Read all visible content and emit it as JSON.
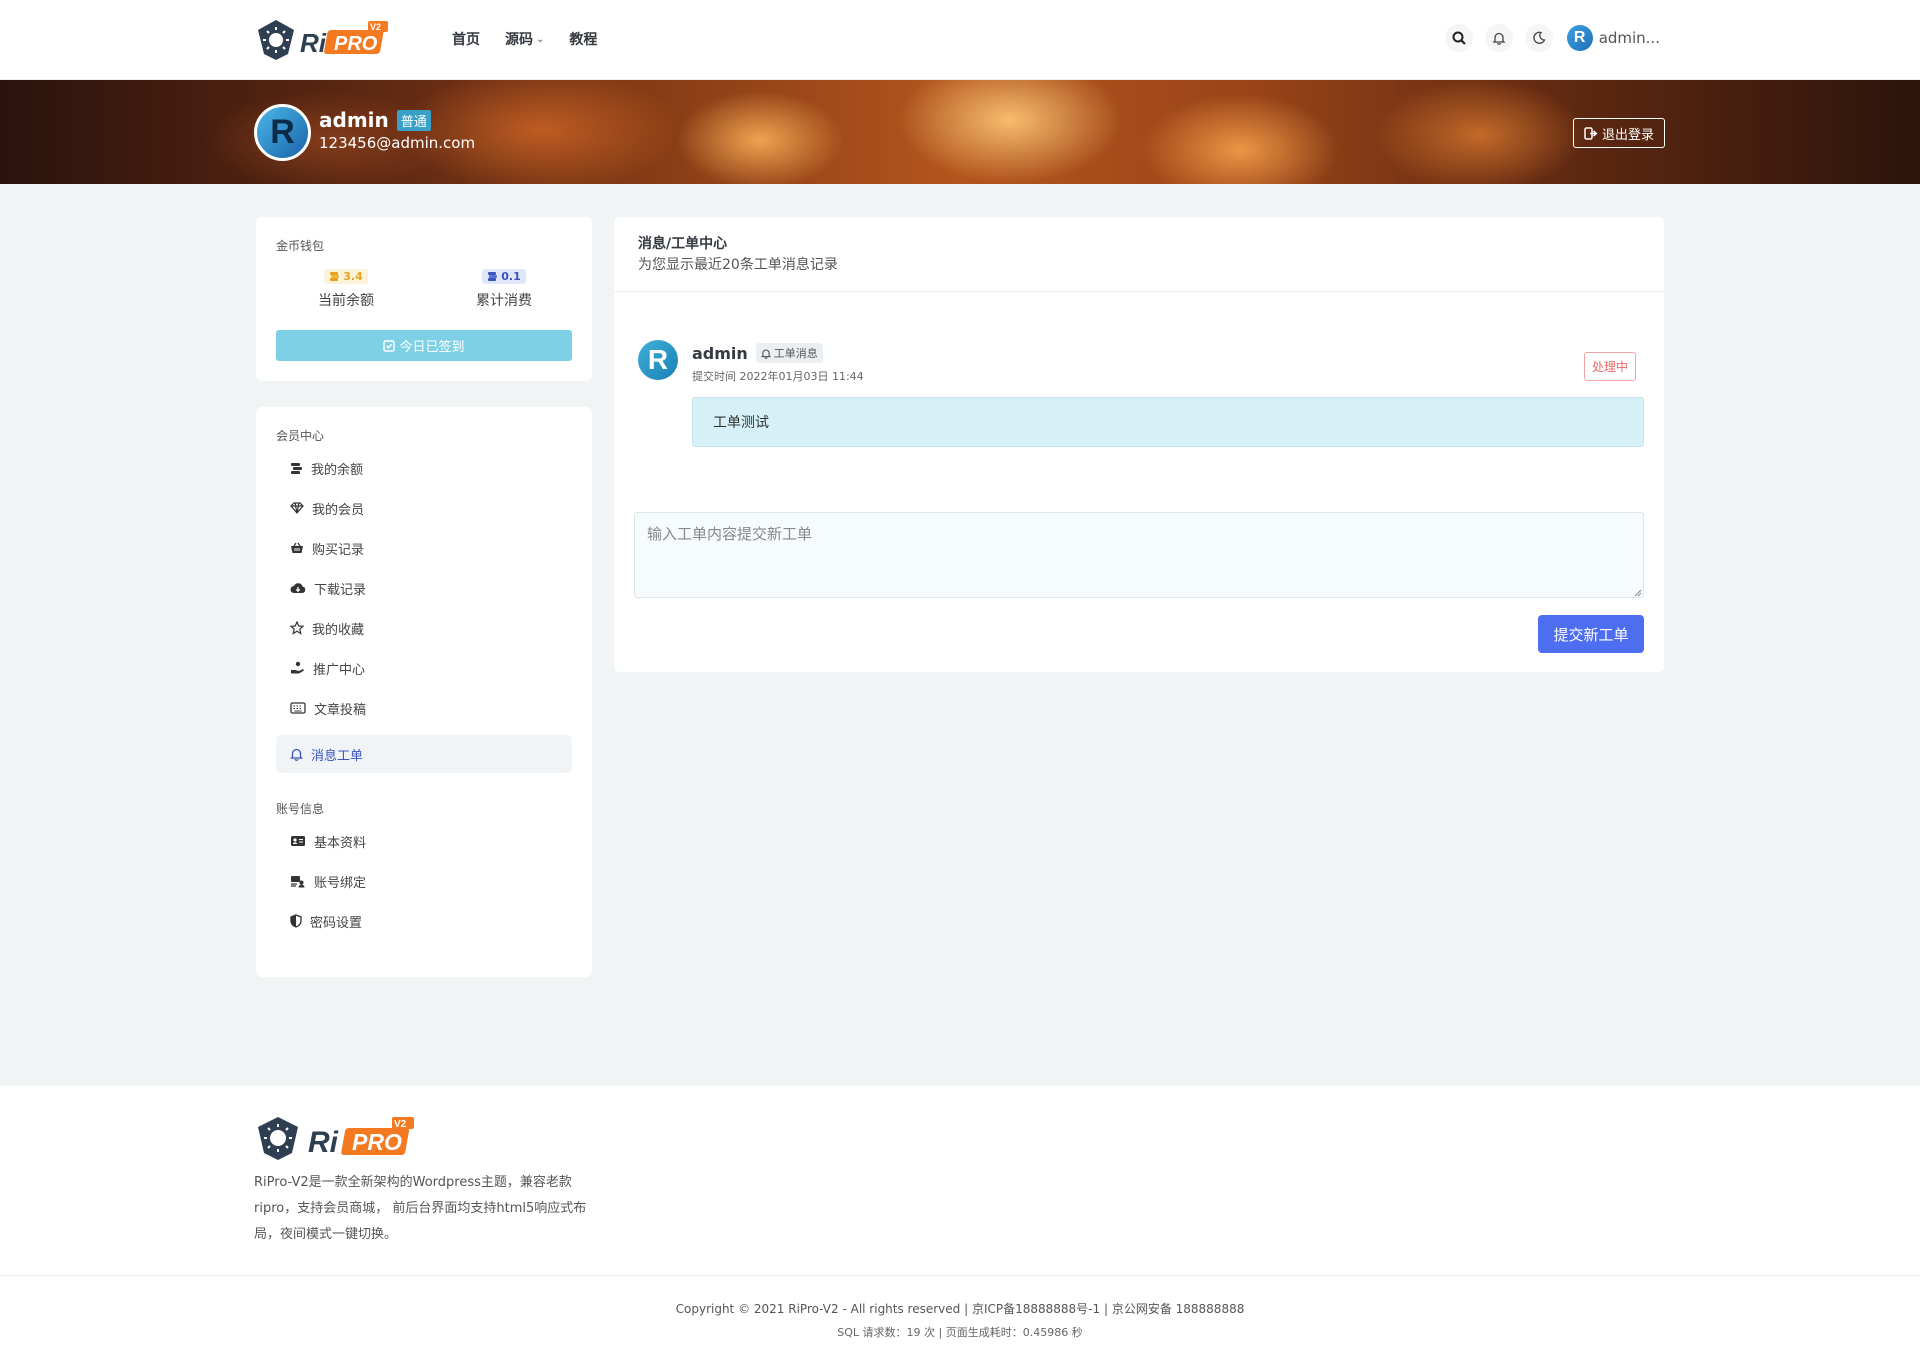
{
  "header": {
    "nav": [
      {
        "label": "首页"
      },
      {
        "label": "源码",
        "has_dropdown": true
      },
      {
        "label": "教程"
      }
    ],
    "user_short": "admin...",
    "icons": [
      "search-icon",
      "bell-icon",
      "moon-icon"
    ]
  },
  "logo": {
    "text_ri": "Ri",
    "text_pro": "PRO",
    "text_v2": "V2"
  },
  "profile": {
    "name": "admin",
    "level": "普通",
    "email": "123456@admin.com",
    "logout_label": "退出登录",
    "avatar_letter": "R"
  },
  "wallet": {
    "title": "金币钱包",
    "balance_value": "3.4",
    "balance_label": "当前余额",
    "spent_value": "0.1",
    "spent_label": "累计消费",
    "checkin_label": "今日已签到"
  },
  "member_center": {
    "title": "会员中心",
    "items": [
      {
        "label": "我的余额",
        "icon": "coins-icon"
      },
      {
        "label": "我的会员",
        "icon": "diamond-icon"
      },
      {
        "label": "购买记录",
        "icon": "basket-icon"
      },
      {
        "label": "下载记录",
        "icon": "cloud-download-icon"
      },
      {
        "label": "我的收藏",
        "icon": "star-icon"
      },
      {
        "label": "推广中心",
        "icon": "hand-coin-icon"
      },
      {
        "label": "文章投稿",
        "icon": "keyboard-icon"
      },
      {
        "label": "消息工单",
        "icon": "bell-icon",
        "active": true
      }
    ]
  },
  "account_info": {
    "title": "账号信息",
    "items": [
      {
        "label": "基本资料",
        "icon": "id-card-icon"
      },
      {
        "label": "账号绑定",
        "icon": "link-user-icon"
      },
      {
        "label": "密码设置",
        "icon": "shield-icon"
      }
    ]
  },
  "ticket": {
    "title": "消息/工单中心",
    "subtitle": "为您显示最近20条工单消息记录",
    "message": {
      "author": "admin",
      "tag": "工单消息",
      "time": "提交时间 2022年01月03日 11:44",
      "status": "处理中",
      "content": "工单测试"
    },
    "input_placeholder": "输入工单内容提交新工单",
    "submit_label": "提交新工单"
  },
  "footer": {
    "description": "RiPro-V2是一款全新架构的Wordpress主题，兼容老款ripro，支持会员商城， 前后台界面均支持html5响应式布局，夜间模式一键切换。",
    "copyright": "Copyright © 2021  RiPro-V2  - All rights reserved |  京ICP备18888888号-1  |  京公网安备 188888888",
    "sql_info": "SQL 请求数：19 次 | 页面生成耗时：0.45986 秒"
  },
  "colors": {
    "primary": "#4e6ef2",
    "checkin": "#7dd0e6",
    "status_red": "#ee6666",
    "bubble": "#d5f0f7"
  }
}
